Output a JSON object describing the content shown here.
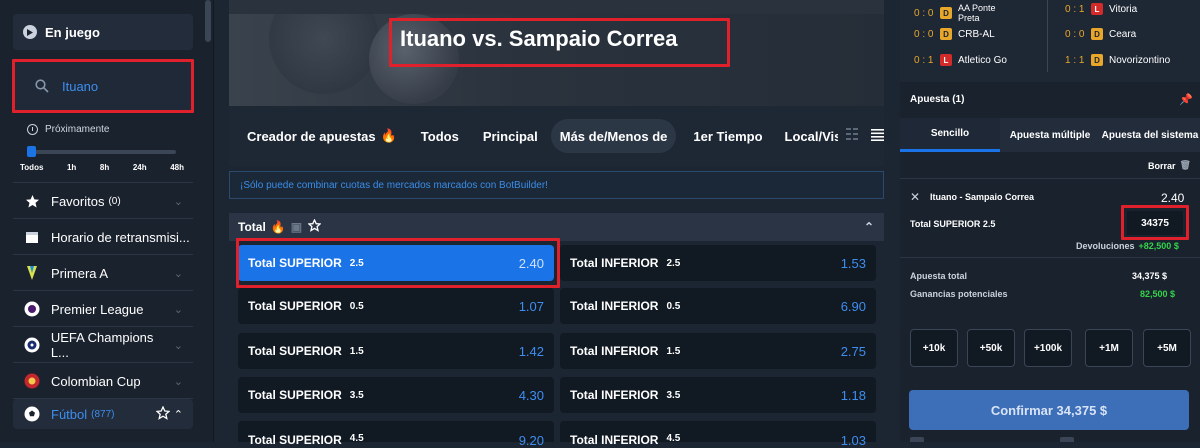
{
  "sidebar": {
    "live_label": "En juego",
    "search_value": "Ituano",
    "soon_label": "Próximamente",
    "time_filters": [
      "Todos",
      "1h",
      "8h",
      "24h",
      "48h"
    ],
    "items": [
      {
        "label": "Favoritos",
        "count": "(0)"
      },
      {
        "label": "Horario de retransmisi..."
      },
      {
        "label": "Primera A"
      },
      {
        "label": "Premier League"
      },
      {
        "label": "UEFA Champions L..."
      },
      {
        "label": "Colombian Cup"
      },
      {
        "label": "Fútbol",
        "count": "(877)"
      }
    ]
  },
  "main": {
    "match_title": "Ituano vs. Sampaio Correa",
    "tabs": [
      "Creador de apuestas",
      "Todos",
      "Principal",
      "Más de/Menos de",
      "1er Tiempo",
      "Local/Visita"
    ],
    "info_text": "¡Sólo puede combinar cuotas de mercados marcados con BotBuilder!",
    "market_title": "Total",
    "odds": [
      {
        "left": {
          "name": "Total SUPERIOR",
          "line": "2.5",
          "value": "2.40"
        },
        "right": {
          "name": "Total INFERIOR",
          "line": "2.5",
          "value": "1.53"
        }
      },
      {
        "left": {
          "name": "Total SUPERIOR",
          "line": "0.5",
          "value": "1.07"
        },
        "right": {
          "name": "Total INFERIOR",
          "line": "0.5",
          "value": "6.90"
        }
      },
      {
        "left": {
          "name": "Total SUPERIOR",
          "line": "1.5",
          "value": "1.42"
        },
        "right": {
          "name": "Total INFERIOR",
          "line": "1.5",
          "value": "2.75"
        }
      },
      {
        "left": {
          "name": "Total SUPERIOR",
          "line": "3.5",
          "value": "4.30"
        },
        "right": {
          "name": "Total INFERIOR",
          "line": "3.5",
          "value": "1.18"
        }
      },
      {
        "left": {
          "name": "Total SUPERIOR",
          "line": "4.5",
          "value": "9.20"
        },
        "right": {
          "name": "Total INFERIOR",
          "line": "4.5",
          "value": "1.03"
        }
      }
    ]
  },
  "right": {
    "scores": [
      {
        "score": "0 : 0",
        "badge": "D",
        "team": "AA Ponte Preta",
        "score2": "0 : 1",
        "badge2": "L",
        "team2": "Vitoria"
      },
      {
        "score": "0 : 0",
        "badge": "D",
        "team": "CRB-AL",
        "score2": "0 : 0",
        "badge2": "D",
        "team2": "Ceara"
      },
      {
        "score": "0 : 1",
        "badge": "L",
        "team": "Atletico Go",
        "score2": "1 : 1",
        "badge2": "D",
        "team2": "Novorizontino"
      }
    ],
    "bet_header": "Apuesta (1)",
    "tabs": [
      "Sencillo",
      "Apuesta múltiple",
      "Apuesta del sistema"
    ],
    "delete_label": "Borrar",
    "selection_match": "Ituano - Sampaio Correa",
    "selection_odds": "2.40",
    "selection_market": "Total SUPERIOR 2.5",
    "stake": "34375",
    "returns_label": "Devoluciones",
    "returns_value": "+82,500 $",
    "total_stake_label": "Apuesta total",
    "total_stake_value": "34,375 $",
    "potential_label": "Ganancias potenciales",
    "potential_value": "82,500 $",
    "quick": [
      "+10k",
      "+50k",
      "+100k",
      "+1M",
      "+5M"
    ],
    "confirm_label": "Confirmar 34,375 $"
  }
}
